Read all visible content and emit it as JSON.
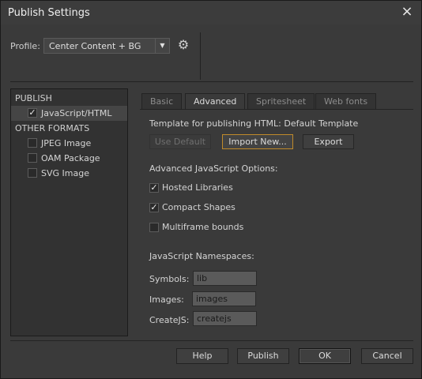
{
  "window": {
    "title": "Publish Settings",
    "close_icon": "×"
  },
  "profile": {
    "label": "Profile:",
    "value": "Center Content + BG",
    "gear_icon": "⚙"
  },
  "left_panel": {
    "section_publish": "PUBLISH",
    "publish_items": [
      {
        "label": "JavaScript/HTML",
        "checked": true
      }
    ],
    "section_other": "OTHER FORMATS",
    "other_items": [
      {
        "label": "JPEG Image",
        "checked": false
      },
      {
        "label": "OAM Package",
        "checked": false
      },
      {
        "label": "SVG Image",
        "checked": false
      }
    ]
  },
  "tabs": [
    "Basic",
    "Advanced",
    "Spritesheet",
    "Web fonts"
  ],
  "active_tab": "Advanced",
  "template": {
    "label": "Template for publishing HTML: Default Template",
    "use_default": "Use Default",
    "import_new": "Import New...",
    "export": "Export"
  },
  "js_options": {
    "heading": "Advanced JavaScript Options:",
    "hosted_libraries": {
      "label": "Hosted Libraries",
      "checked": true
    },
    "compact_shapes": {
      "label": "Compact Shapes",
      "checked": true
    },
    "multiframe_bounds": {
      "label": "Multiframe bounds",
      "checked": false
    }
  },
  "namespaces": {
    "heading": "JavaScript Namespaces:",
    "symbols": {
      "label": "Symbols:",
      "value": "lib"
    },
    "images": {
      "label": "Images:",
      "value": "images"
    },
    "createjs": {
      "label": "CreateJS:",
      "value": "createjs"
    }
  },
  "footer": {
    "help": "Help",
    "publish": "Publish",
    "ok": "OK",
    "cancel": "Cancel"
  },
  "check_mark": "✓"
}
